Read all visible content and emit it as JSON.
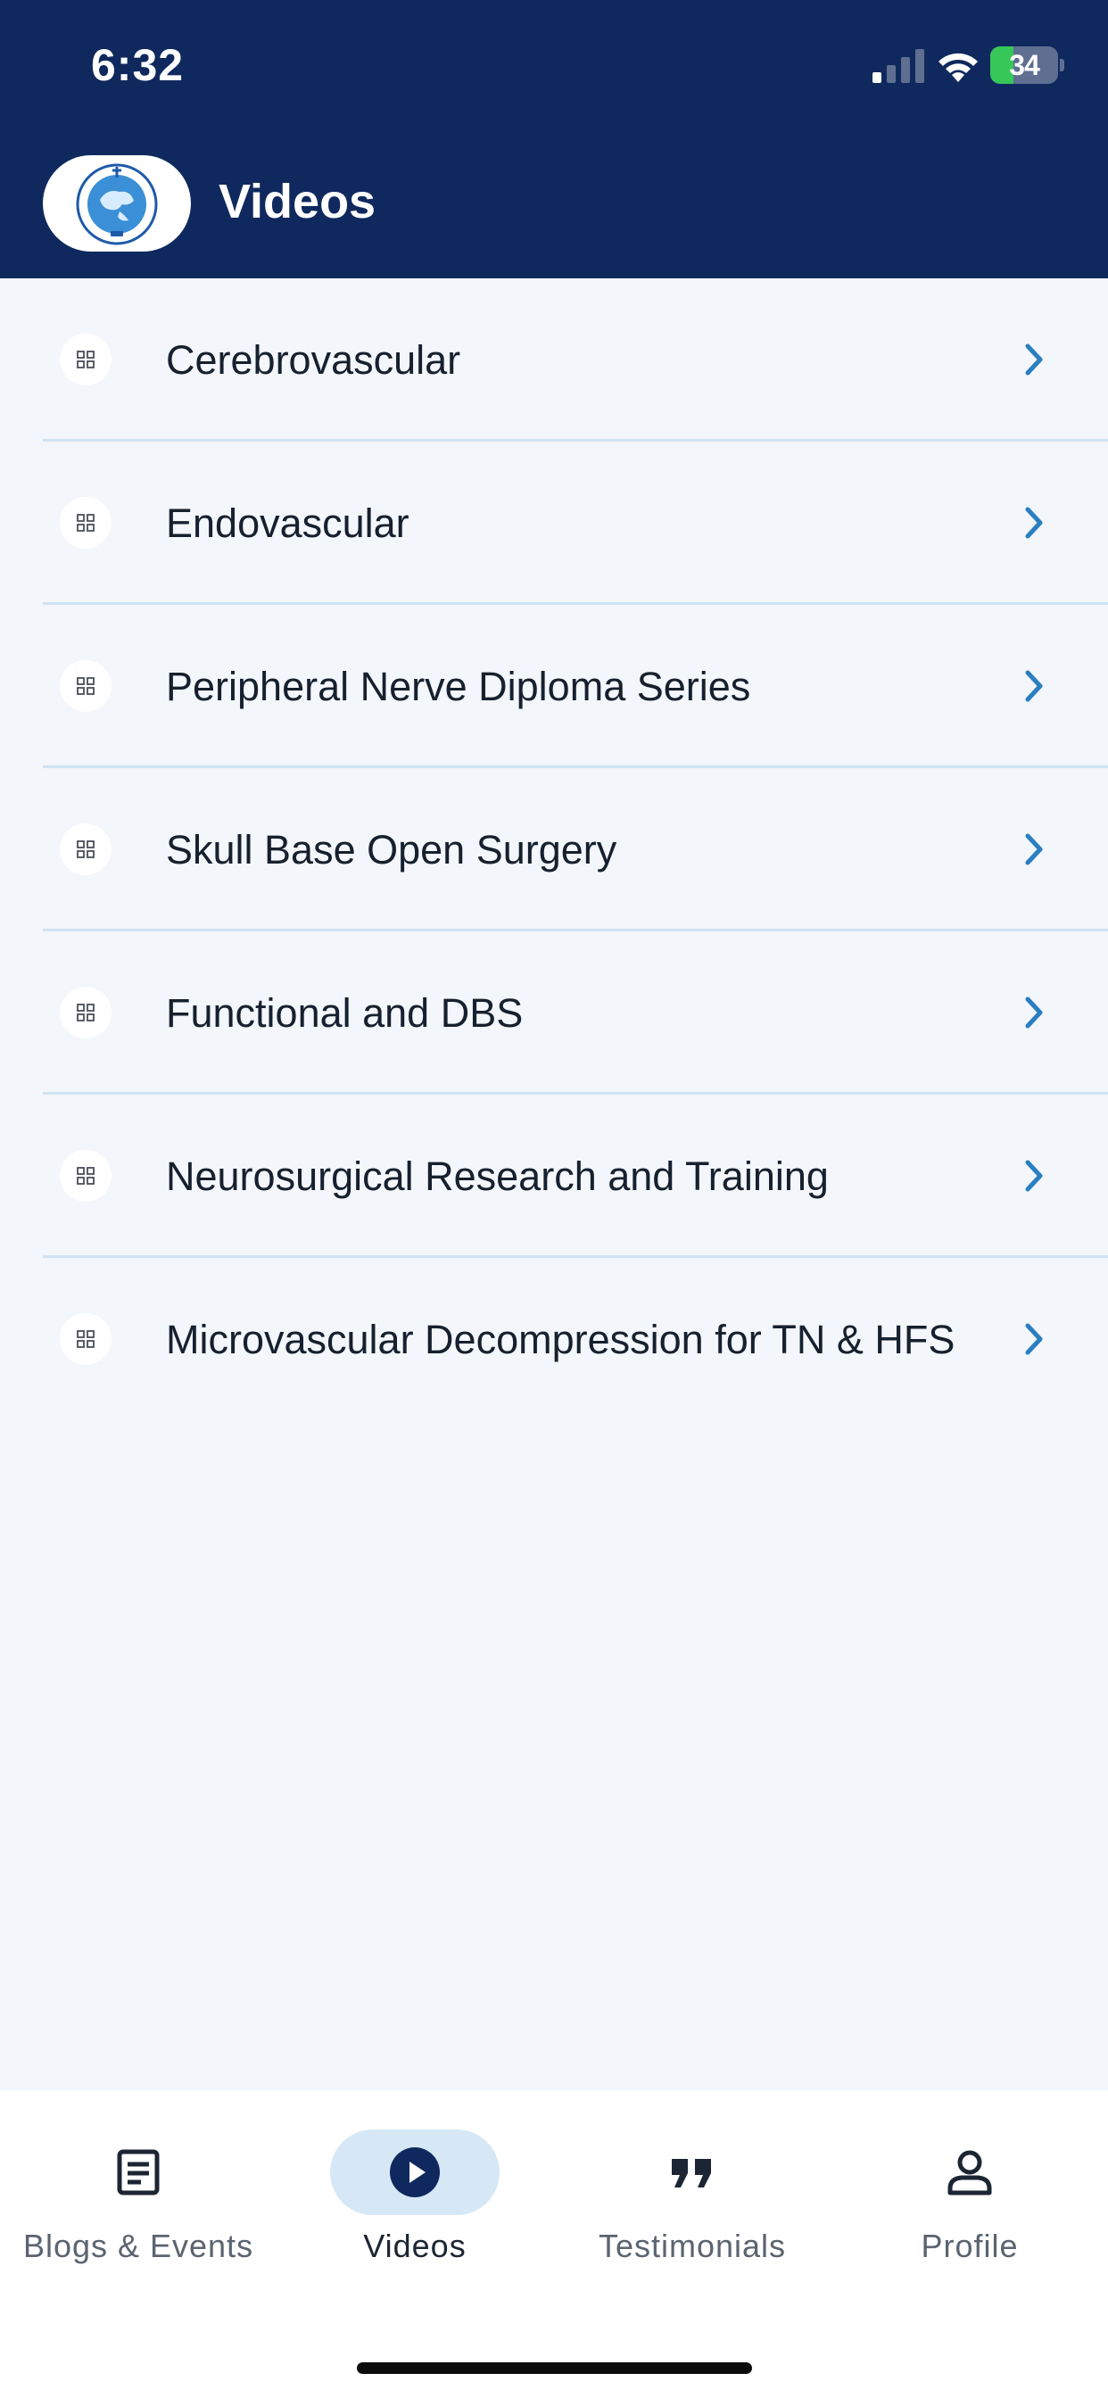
{
  "status_bar": {
    "time": "6:32",
    "battery_level": "34",
    "battery_fraction": 0.34,
    "signal_bars": 1
  },
  "header": {
    "title": "Videos",
    "logo_icon": "society-globe-logo",
    "background_color": "#0f295e"
  },
  "categories": [
    {
      "label": "Cerebrovascular",
      "icon": "grid-icon"
    },
    {
      "label": "Endovascular",
      "icon": "grid-icon"
    },
    {
      "label": "Peripheral Nerve Diploma Series",
      "icon": "grid-icon"
    },
    {
      "label": "Skull Base Open Surgery",
      "icon": "grid-icon"
    },
    {
      "label": "Functional and DBS",
      "icon": "grid-icon"
    },
    {
      "label": "Neurosurgical Research and Training",
      "icon": "grid-icon"
    },
    {
      "label": "Microvascular Decompression for TN & HFS",
      "icon": "grid-icon"
    }
  ],
  "tabs": [
    {
      "label": "Blogs & Events",
      "icon": "article-icon",
      "active": false
    },
    {
      "label": "Videos",
      "icon": "play-circle-icon",
      "active": true
    },
    {
      "label": "Testimonials",
      "icon": "quote-icon",
      "active": false
    },
    {
      "label": "Profile",
      "icon": "person-icon",
      "active": false
    }
  ],
  "colors": {
    "accent": "#2a7fc0",
    "active_tab_pill": "#d6e8f6",
    "list_background": "#f3f6fa",
    "battery_green": "#37c759"
  }
}
